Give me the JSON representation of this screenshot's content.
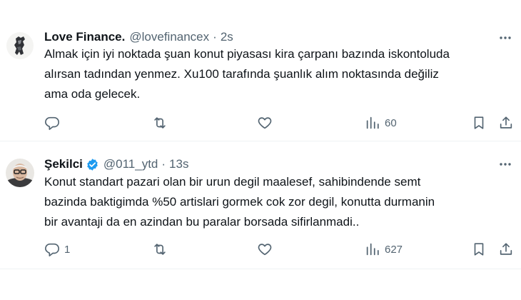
{
  "tweets": [
    {
      "name": "Love Finance.",
      "handle": "@lovefinancex",
      "separator": "·",
      "time": "2s",
      "verified": false,
      "lines": [
        "Almak için iyi noktada şuan konut piyasası kira çarpanı bazında iskontoluda",
        "alırsan tadından yenmez. Xu100 tarafında şuanlık alım noktasında değiliz",
        "ama oda gelecek."
      ],
      "reply_count": "",
      "retweet_count": "",
      "like_count": "",
      "views": "60"
    },
    {
      "name": "Şekilci",
      "handle": "@011_ytd",
      "separator": "·",
      "time": "13s",
      "verified": true,
      "lines": [
        "Konut standart pazari olan bir urun degil maalesef, sahibindende semt",
        "bazinda baktigimda %50 artislari gormek cok zor degil, konutta durmanin",
        "bir avantaji da en azindan bu paralar borsada sifirlanmadi.."
      ],
      "reply_count": "1",
      "retweet_count": "",
      "like_count": "",
      "views": "627"
    }
  ],
  "colors": {
    "text": "#0f1419",
    "secondary": "#536471",
    "verified": "#1d9bf0",
    "divider": "#eff3f4"
  },
  "icons": [
    "more-icon",
    "reply-icon",
    "retweet-icon",
    "like-icon",
    "views-icon",
    "bookmark-icon",
    "share-icon",
    "verified-badge-icon"
  ]
}
